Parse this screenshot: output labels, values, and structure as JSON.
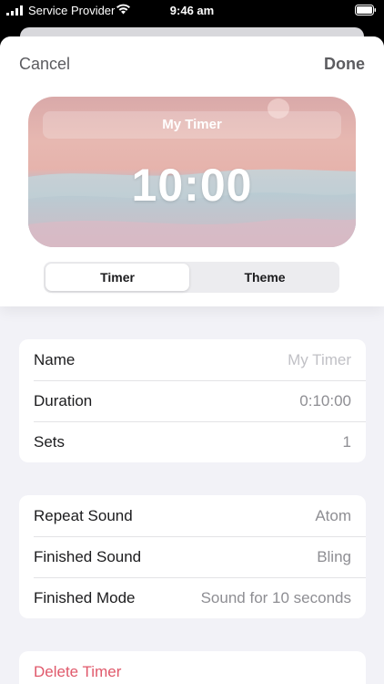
{
  "status_bar": {
    "carrier": "Service Provider",
    "time": "9:46 am"
  },
  "nav": {
    "cancel_label": "Cancel",
    "done_label": "Done"
  },
  "preview": {
    "title": "My Timer",
    "time": "10:00"
  },
  "segmented": {
    "options": [
      "Timer",
      "Theme"
    ],
    "selected": "Timer"
  },
  "group1": {
    "rows": [
      {
        "label": "Name",
        "value": "My Timer"
      },
      {
        "label": "Duration",
        "value": "0:10:00"
      },
      {
        "label": "Sets",
        "value": "1"
      }
    ]
  },
  "group2": {
    "rows": [
      {
        "label": "Repeat Sound",
        "value": "Atom"
      },
      {
        "label": "Finished Sound",
        "value": "Bling"
      },
      {
        "label": "Finished Mode",
        "value": "Sound for 10 seconds"
      }
    ]
  },
  "group3": {
    "delete_label": "Delete Timer"
  },
  "colors": {
    "destructive": "#e0596b",
    "secondary_text": "#8e8e93",
    "background": "#f2f2f7"
  }
}
